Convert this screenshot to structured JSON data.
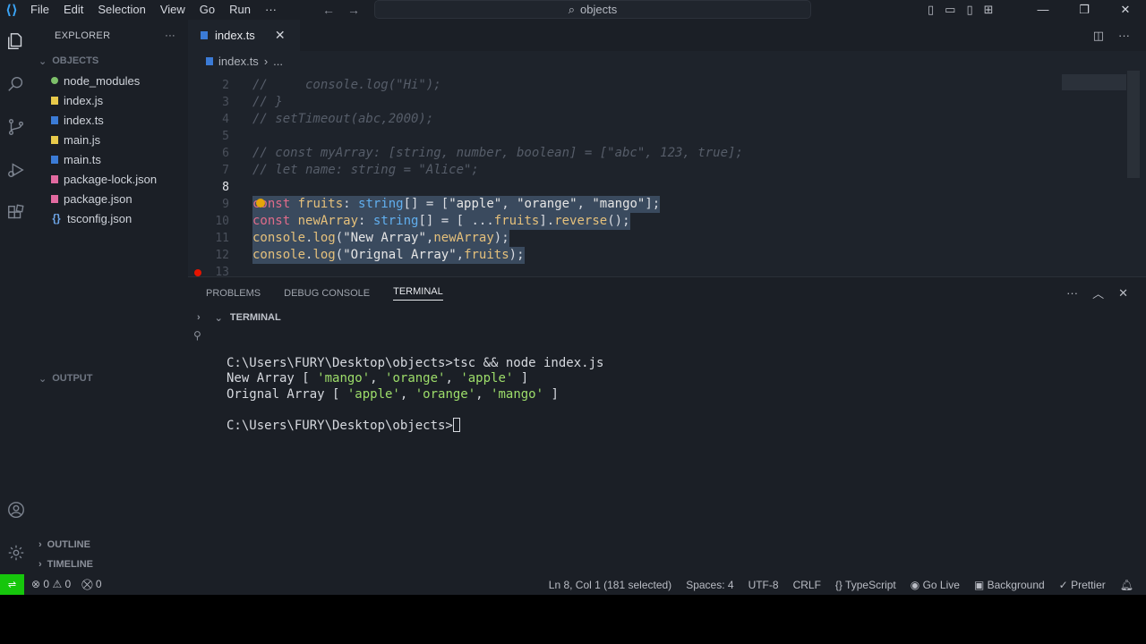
{
  "titlebar": {
    "menus": [
      "File",
      "Edit",
      "Selection",
      "View",
      "Go",
      "Run",
      "···"
    ],
    "search_text": "objects"
  },
  "sidebar": {
    "title": "EXPLORER",
    "folder": "OBJECTS",
    "files": [
      {
        "name": "node_modules",
        "icon": "folder-dot-icon"
      },
      {
        "name": "index.js",
        "icon": "js-file-icon"
      },
      {
        "name": "index.ts",
        "icon": "ts-file-icon"
      },
      {
        "name": "main.js",
        "icon": "js-file-icon"
      },
      {
        "name": "main.ts",
        "icon": "ts-file-icon"
      },
      {
        "name": "package-lock.json",
        "icon": "json-file-icon"
      },
      {
        "name": "package.json",
        "icon": "json-file-icon"
      },
      {
        "name": "tsconfig.json",
        "icon": "json-braces-icon"
      }
    ],
    "output_label": "OUTPUT",
    "outline_label": "OUTLINE",
    "timeline_label": "TIMELINE"
  },
  "editor": {
    "tab_label": "index.ts",
    "breadcrumb_file": "index.ts",
    "breadcrumb_more": "...",
    "line_numbers": [
      "2",
      "3",
      "4",
      "5",
      "6",
      "7",
      "8",
      "9",
      "10",
      "11",
      "12",
      "13"
    ],
    "lines": {
      "l2": "//     console.log(\"Hi\");",
      "l3": "// }",
      "l4": "// setTimeout(abc,2000);",
      "l6": "// const myArray: [string, number, boolean] = [\"abc\", 123, true];",
      "l7": "// let name: string = \"Alice\";"
    }
  },
  "panel": {
    "tabs": [
      "PROBLEMS",
      "DEBUG CONSOLE",
      "TERMINAL"
    ],
    "terminal_label": "TERMINAL",
    "terminal_lines": {
      "cmd": "C:\\Users\\FURY\\Desktop\\objects>tsc && node index.js",
      "new_prefix": "New Array [ ",
      "orig_prefix": "Orignal Array [ ",
      "prompt": "C:\\Users\\FURY\\Desktop\\objects>"
    },
    "new_array": [
      "'mango'",
      "'orange'",
      "'apple'"
    ],
    "orig_array": [
      "'apple'",
      "'orange'",
      "'mango'"
    ]
  },
  "status": {
    "errors": "0",
    "warnings": "0",
    "ports": "0",
    "position": "Ln 8, Col 1 (181 selected)",
    "spaces": "Spaces: 4",
    "encoding": "UTF-8",
    "eol": "CRLF",
    "language": "TypeScript",
    "golive": "Go Live",
    "background": "Background",
    "prettier": "Prettier"
  },
  "colors": {
    "accent": "#16c60c",
    "keyword": "#e06c8a",
    "type": "#61afef",
    "terminal_string": "#9ddd6a"
  }
}
